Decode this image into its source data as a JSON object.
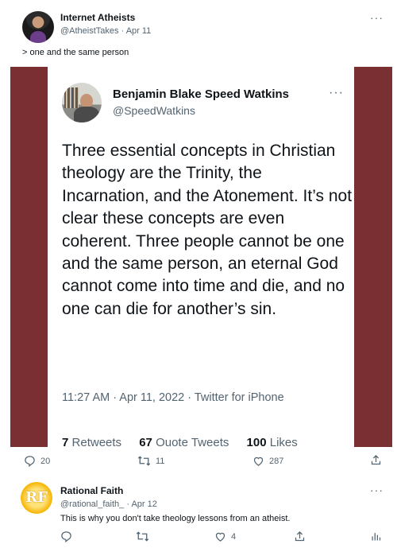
{
  "tweet1": {
    "name": "Internet Atheists",
    "handle_date": "@AtheistTakes · Apr 11",
    "text": "> one and the same person",
    "actions": {
      "replies": "20",
      "retweets": "11",
      "likes": "287"
    }
  },
  "embedded": {
    "name": "Benjamin Blake Speed Watkins",
    "handle": "@SpeedWatkins",
    "text": "Three essential concepts in Christian theology are the Trinity, the Incarnation, and the Atonement. It’s not clear these concepts are even coherent. Three people cannot be one and the same person, an eternal God cannot come into time and die, and no one can die for another’s sin.",
    "meta": "11:27 AM · Apr 11, 2022 · Twitter for iPhone",
    "stats": {
      "retweets_count": "7",
      "retweets_label": "Retweets",
      "quotes_count": "67",
      "quotes_label": "Ouote Tweets",
      "likes_count": "100",
      "likes_label": "Likes"
    },
    "frame_color": "#7a2f33"
  },
  "tweet2": {
    "name": "Rational Faith",
    "handle_date": "@rational_faith_ · Apr 12",
    "text": "This is why you don't take theology lessons from an atheist.",
    "avatar_text": "RF",
    "actions": {
      "replies": "",
      "retweets": "",
      "likes": "4"
    }
  },
  "more_glyph": "···",
  "icons": [
    "reply-icon",
    "retweet-icon",
    "like-icon",
    "share-icon",
    "analytics-icon"
  ]
}
